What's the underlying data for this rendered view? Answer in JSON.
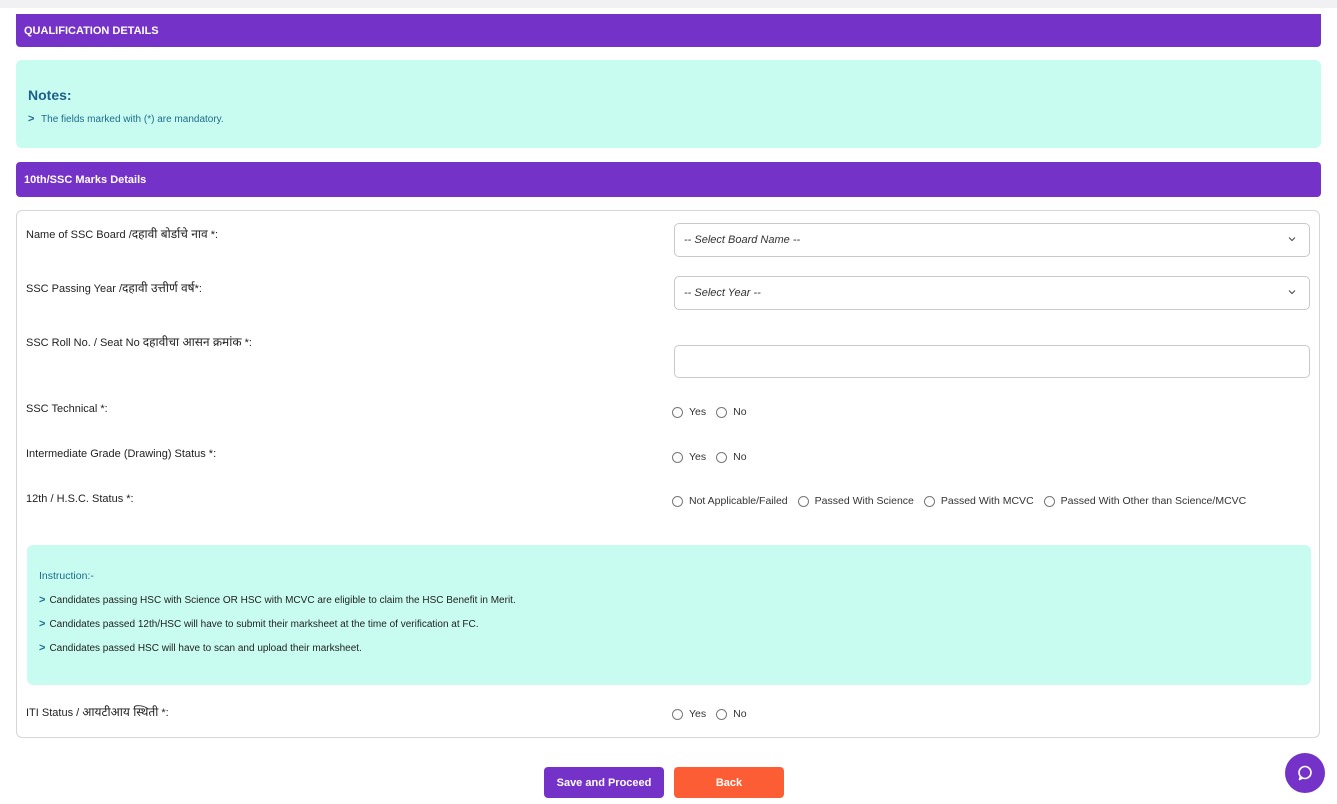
{
  "section_header": "QUALIFICATION DETAILS",
  "notes": {
    "title": "Notes:",
    "items": [
      "The fields marked with (*) are mandatory."
    ]
  },
  "ssc_header": "10th/SSC Marks Details",
  "fields": {
    "board": {
      "label": "Name of SSC Board /",
      "label_mr": "दहावी बोर्डाचे नाव",
      "suffix": " *:",
      "selected": "-- Select Board Name --"
    },
    "year": {
      "label": "SSC Passing Year /",
      "label_mr": "दहावी उत्तीर्ण वर्ष",
      "suffix": "*:",
      "selected": "-- Select Year --"
    },
    "roll": {
      "label": "SSC Roll No. / Seat No ",
      "label_mr": "दहावीचा आसन क्रमांक",
      "suffix": " *:",
      "value": ""
    },
    "technical": {
      "label": "SSC Technical *:",
      "options": [
        "Yes",
        "No"
      ]
    },
    "drawing": {
      "label": "Intermediate Grade (Drawing) Status *:",
      "options": [
        "Yes",
        "No"
      ]
    },
    "hsc": {
      "label": "12th / H.S.C. Status *:",
      "options": [
        "Not Applicable/Failed",
        "Passed With Science",
        "Passed With MCVC",
        "Passed With Other than Science/MCVC"
      ]
    },
    "iti": {
      "label": "ITI Status / ",
      "label_mr": "आयटीआय स्थिती",
      "suffix": " *:",
      "options": [
        "Yes",
        "No"
      ]
    }
  },
  "instruction": {
    "title": "Instruction:-",
    "items": [
      "Candidates passing HSC with Science OR HSC with MCVC are eligible to claim the HSC Benefit in Merit.",
      "Candidates passed 12th/HSC will have to submit their marksheet at the time of verification at FC.",
      "Candidates passed HSC will have to scan and upload their marksheet."
    ]
  },
  "buttons": {
    "save": "Save and Proceed",
    "back": "Back"
  },
  "icons": {
    "chevron": "chevron-right-icon",
    "dropdown": "chevron-down-icon",
    "chat": "chat-bubble-icon"
  },
  "colors": {
    "primary": "#7532c8",
    "info_bg": "#c8fcf1",
    "back": "#fd5d35"
  }
}
